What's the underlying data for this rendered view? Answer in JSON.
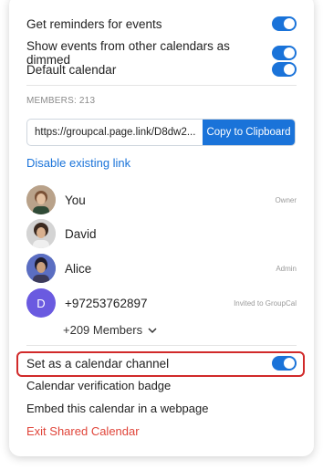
{
  "settings": {
    "reminders_label": "Get reminders for events",
    "dimmed_label": "Show events from other calendars as dimmed",
    "default_label": "Default calendar"
  },
  "members": {
    "count_label": "MEMBERS: 213",
    "link_url": "https://groupcal.page.link/D8dw2...",
    "copy_label": "Copy to Clipboard",
    "disable_link_label": "Disable existing link",
    "list": [
      {
        "name": "You",
        "role": "Owner"
      },
      {
        "name": "David",
        "role": ""
      },
      {
        "name": "Alice",
        "role": "Admin"
      },
      {
        "name": "+97253762897",
        "role": "Invited to GroupCal",
        "initial": "D"
      }
    ],
    "more_label": "+209 Members"
  },
  "options": {
    "channel_label": "Set as a calendar channel",
    "badge_label": "Calendar verification badge",
    "embed_label": "Embed this calendar in a webpage",
    "exit_label": "Exit Shared Calendar"
  },
  "colors": {
    "accent": "#1a73d9",
    "danger": "#e0453a",
    "highlight_border": "#d12a2a",
    "invite_avatar": "#6a5ae0"
  },
  "icons": {
    "more": "chevron-down-icon",
    "toggle": "toggle-switch-icon"
  }
}
